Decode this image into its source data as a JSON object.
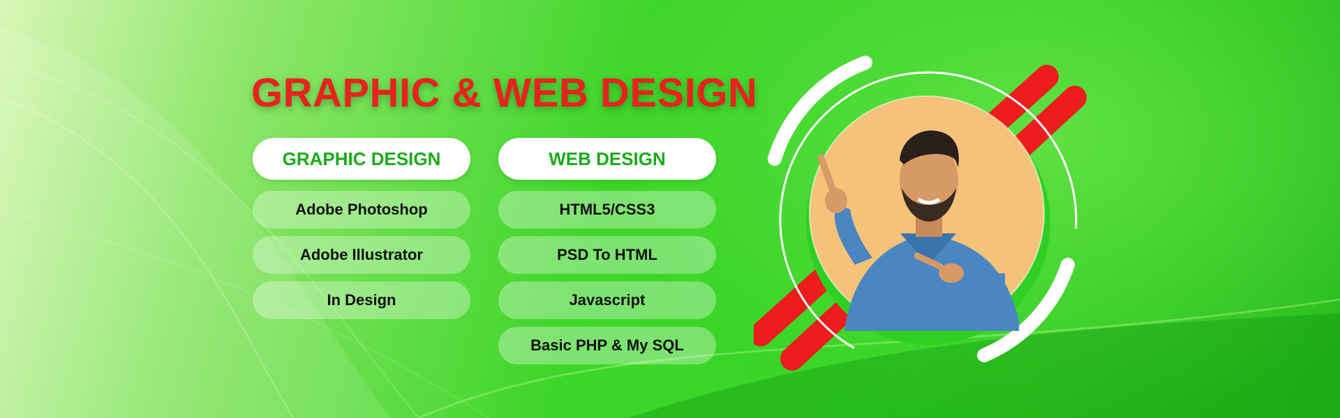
{
  "banner": {
    "headline": "GRAPHIC & WEB DESIGN"
  },
  "graphic_design": {
    "title": "GRAPHIC DESIGN",
    "items": [
      "Adobe Photoshop",
      "Adobe Illustrator",
      "In Design"
    ]
  },
  "web_design": {
    "title": "WEB DESIGN",
    "items": [
      "HTML5/CSS3",
      "PSD To HTML",
      "Javascript",
      "Basic PHP & My SQL"
    ]
  },
  "colors": {
    "headline": "#e8231e",
    "accent_green": "#1aab1a",
    "background_green": "#33d424",
    "stripe_red": "#ee1c1c",
    "circle_fill": "#f5c27a"
  },
  "image": {
    "subject": "smiling man pointing upward"
  }
}
